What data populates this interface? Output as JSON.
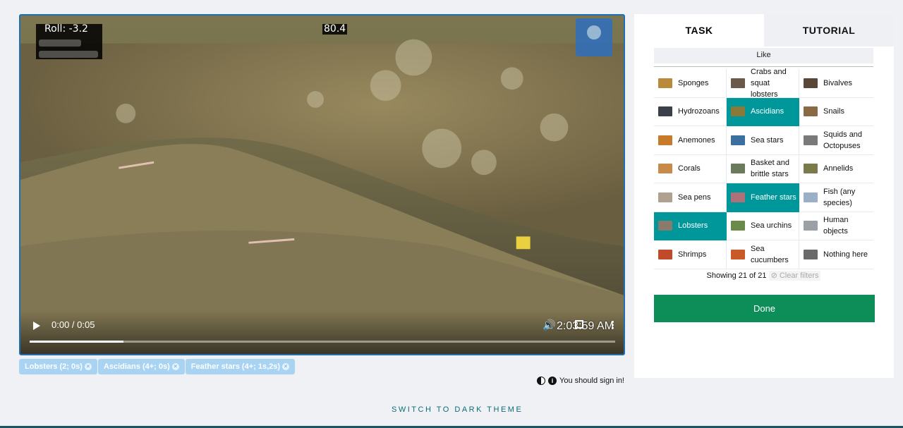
{
  "video": {
    "roll": "Roll: -3.2",
    "heading": "80.4",
    "time": "0:00 / 0:05",
    "timestamp": "2:03:59 AM",
    "progress": 0.16
  },
  "tags": [
    {
      "label": "Lobsters (2; 0s)"
    },
    {
      "label": "Ascidians (4+; 0s)"
    },
    {
      "label": "Feather stars (4+; 1s,2s)"
    }
  ],
  "signin": {
    "text": "You should sign in!"
  },
  "footer": {
    "dark_theme": "SWITCH TO DARK THEME"
  },
  "panel": {
    "tabs": [
      {
        "label": "TASK"
      },
      {
        "label": "TUTORIAL"
      }
    ],
    "like": "Like",
    "options": [
      {
        "label": "Sponges",
        "color": "#b98a3a",
        "selected": false
      },
      {
        "label": "Crabs and squat lobsters",
        "color": "#6b5a4a",
        "selected": false
      },
      {
        "label": "Bivalves",
        "color": "#5a4636",
        "selected": false
      },
      {
        "label": "Hydrozoans",
        "color": "#3a3f4a",
        "selected": false
      },
      {
        "label": "Ascidians",
        "color": "#8a7a3a",
        "selected": true
      },
      {
        "label": "Snails",
        "color": "#8a6a44",
        "selected": false
      },
      {
        "label": "Anemones",
        "color": "#c77a2a",
        "selected": false
      },
      {
        "label": "Sea stars",
        "color": "#3a6fa0",
        "selected": false
      },
      {
        "label": "Squids and Octopuses",
        "color": "#7a7a7a",
        "selected": false
      },
      {
        "label": "Corals",
        "color": "#c78a4a",
        "selected": false
      },
      {
        "label": "Basket and brittle stars",
        "color": "#6a7a5a",
        "selected": false
      },
      {
        "label": "Annelids",
        "color": "#7a7a4a",
        "selected": false
      },
      {
        "label": "Sea pens",
        "color": "#b0a090",
        "selected": false
      },
      {
        "label": "Feather stars",
        "color": "#b0707a",
        "selected": true
      },
      {
        "label": "Fish (any species)",
        "color": "#9ab0c8",
        "selected": false
      },
      {
        "label": "Lobsters",
        "color": "#8a7a6a",
        "selected": true
      },
      {
        "label": "Sea urchins",
        "color": "#6a8a4a",
        "selected": false
      },
      {
        "label": "Human objects",
        "color": "#9aa0a6",
        "selected": false
      },
      {
        "label": "Shrimps",
        "color": "#c04a2a",
        "selected": false
      },
      {
        "label": "Sea cucumbers",
        "color": "#c85a2a",
        "selected": false
      },
      {
        "label": "Nothing here",
        "color": "#6a6a6a",
        "selected": false
      }
    ],
    "showing": "Showing 21 of 21",
    "clear_filters": "Clear filters",
    "done": "Done"
  },
  "colors": {
    "selected": "#00979a",
    "done": "#0d8e58",
    "tag": "#a9d3f2",
    "accent": "#0e6c77"
  }
}
